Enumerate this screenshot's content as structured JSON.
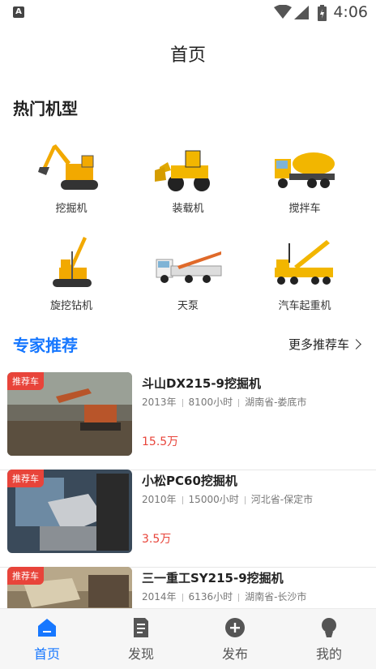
{
  "status": {
    "time": "4:06"
  },
  "header": {
    "title": "首页"
  },
  "hot": {
    "title": "热门机型",
    "items": [
      {
        "label": "挖掘机"
      },
      {
        "label": "装载机"
      },
      {
        "label": "搅拌车"
      },
      {
        "label": "旋挖钻机"
      },
      {
        "label": "天泵"
      },
      {
        "label": "汽车起重机"
      }
    ]
  },
  "expert": {
    "title": "专家推荐",
    "more_label": "更多推荐车",
    "cards": [
      {
        "badge": "推荐车",
        "title": "斗山DX215-9挖掘机",
        "year": "2013年",
        "hours": "8100小时",
        "location": "湖南省-娄底市",
        "price": "15.5万"
      },
      {
        "badge": "推荐车",
        "title": "小松PC60挖掘机",
        "year": "2010年",
        "hours": "15000小时",
        "location": "河北省-保定市",
        "price": "3.5万"
      },
      {
        "badge": "推荐车",
        "title": "三一重工SY215-9挖掘机",
        "year": "2014年",
        "hours": "6136小时",
        "location": "湖南省-长沙市",
        "price": ""
      }
    ]
  },
  "tabs": [
    {
      "label": "首页",
      "icon": "home-icon",
      "active": true
    },
    {
      "label": "发现",
      "icon": "document-icon"
    },
    {
      "label": "发布",
      "icon": "plus-circle-icon"
    },
    {
      "label": "我的",
      "icon": "user-icon"
    }
  ],
  "colors": {
    "accent": "#1677ff",
    "price": "#e8443a",
    "badge": "#e8443a"
  }
}
